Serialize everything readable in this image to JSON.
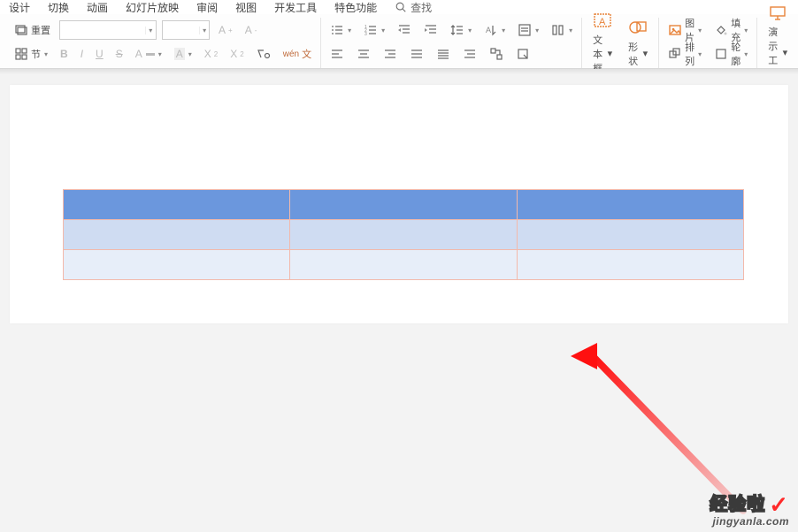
{
  "menu": {
    "items": [
      "设计",
      "切换",
      "动画",
      "幻灯片放映",
      "审阅",
      "视图",
      "开发工具",
      "特色功能"
    ],
    "search": "查找"
  },
  "toolbar": {
    "reset": "重置",
    "section": "节",
    "font_name": "",
    "font_size": "",
    "textbox": "文本框",
    "shape": "形状",
    "picture": "图片",
    "arrange": "排列",
    "fill": "填充",
    "outline": "轮廓",
    "present_tools": "演示工具"
  },
  "watermark": {
    "line1": "经验啦",
    "line2": "jingyanla.com"
  },
  "table": {
    "rows": 3,
    "cols": 3,
    "colors": {
      "header": "#6b97dd",
      "row_alt1": "#cfdcf2",
      "row_alt2": "#e7eef9",
      "border": "#f3b9ab"
    }
  }
}
